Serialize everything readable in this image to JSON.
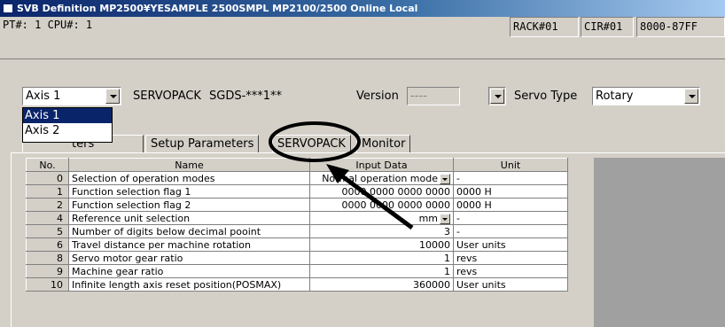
{
  "window": {
    "title": "SVB Definition   MP2500¥YESAMPLE  2500SMPL  MP2100/2500 Online  Local"
  },
  "header": {
    "pt_cpu": "PT#: 1 CPU#: 1",
    "rack": "RACK#01",
    "cir": "CIR#01",
    "range": "8000-87FF"
  },
  "axis_select": {
    "value": "Axis 1",
    "options": [
      "Axis 1",
      "Axis 2"
    ]
  },
  "servopack": {
    "label": "SERVOPACK",
    "model": "SGDS-***1**"
  },
  "version": {
    "label": "Version",
    "value": "----"
  },
  "servo_type": {
    "label": "Servo Type",
    "value": "Rotary"
  },
  "tabs": [
    {
      "label": "Fixed Parameters"
    },
    {
      "label": "Setup Parameters"
    },
    {
      "label": "SERVOPACK"
    },
    {
      "label": "Monitor"
    }
  ],
  "tab_partial_visible": "ters",
  "table": {
    "columns": [
      "No.",
      "Name",
      "Input Data",
      "Unit"
    ],
    "rows": [
      {
        "no": "0",
        "name": "Selection of operation modes",
        "input": "Normal operation mode",
        "unit": "-",
        "dropdown": true
      },
      {
        "no": "1",
        "name": "Function selection flag 1",
        "input": "0000 0000 0000 0000",
        "unit": "0000 H",
        "dropdown": false
      },
      {
        "no": "2",
        "name": "Function selection flag 2",
        "input": "0000 0000 0000 0000",
        "unit": "0000 H",
        "dropdown": false
      },
      {
        "no": "4",
        "name": "Reference unit selection",
        "input": "mm",
        "unit": "-",
        "dropdown": true
      },
      {
        "no": "5",
        "name": "Number of digits below decimal pooint",
        "input": "3",
        "unit": "-",
        "dropdown": false
      },
      {
        "no": "6",
        "name": "Travel distance per machine rotation",
        "input": "10000",
        "unit": "User units",
        "dropdown": false
      },
      {
        "no": "8",
        "name": "Servo motor gear ratio",
        "input": "1",
        "unit": "revs",
        "dropdown": false
      },
      {
        "no": "9",
        "name": "Machine gear ratio",
        "input": "1",
        "unit": "revs",
        "dropdown": false
      },
      {
        "no": "10",
        "name": "Infinite length axis reset position(POSMAX)",
        "input": "360000",
        "unit": "User units",
        "dropdown": false
      }
    ]
  },
  "colors": {
    "titlebar": "#0a246a",
    "face": "#d4d0c8",
    "selection": "#0a246a"
  }
}
